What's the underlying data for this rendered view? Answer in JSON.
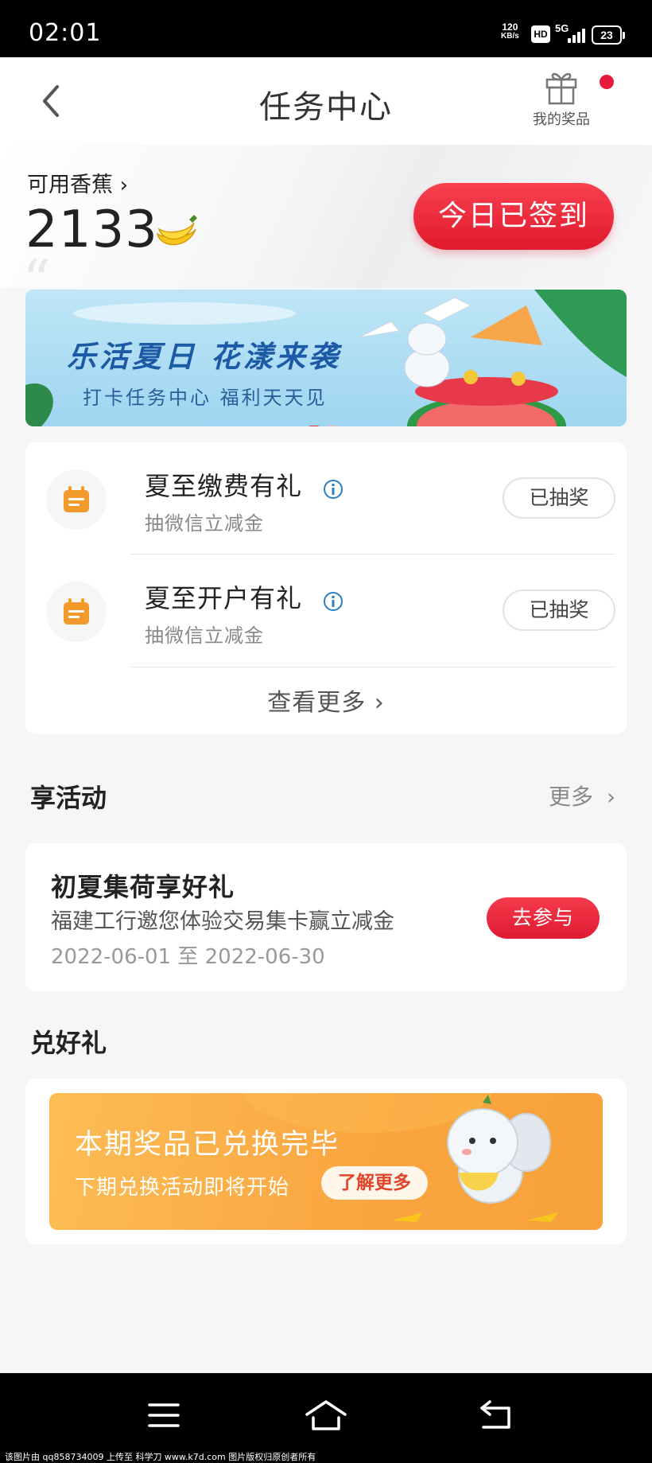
{
  "status_bar": {
    "time": "02:01",
    "speed_value": "120",
    "speed_unit": "KB/s",
    "hd": "HD",
    "network": "5G",
    "battery": "23"
  },
  "header": {
    "title": "任务中心",
    "prizes_label": "我的奖品"
  },
  "hero": {
    "banana_label": "可用香蕉",
    "banana_count": "2133",
    "signed_button": "今日已签到"
  },
  "banner": {
    "title": "乐活夏日  花漾来袭",
    "subtitle": "打卡任务中心 福利天天见"
  },
  "tasks": {
    "items": [
      {
        "title": "夏至缴费有礼",
        "desc": "抽微信立减金",
        "button": "已抽奖"
      },
      {
        "title": "夏至开户有礼",
        "desc": "抽微信立减金",
        "button": "已抽奖"
      }
    ],
    "more_label": "查看更多"
  },
  "activities": {
    "section_title": "享活动",
    "more_label": "更多",
    "item": {
      "title": "初夏集荷享好礼",
      "desc": "福建工行邀您体验交易集卡赢立减金",
      "date": "2022-06-01 至 2022-06-30",
      "button": "去参与"
    }
  },
  "redeem": {
    "section_title": "兑好礼",
    "title": "本期奖品已兑换完毕",
    "subtitle": "下期兑换活动即将开始",
    "button": "了解更多"
  },
  "footer": {
    "watermark": "该图片由 qq858734009 上传至 科学刀 www.k7d.com 图片版权归原创者所有"
  },
  "colors": {
    "accent_red": "#e11a2e",
    "task_icon_orange": "#f39a2c",
    "info_blue": "#2a7fc4",
    "redeem_orange": "#f9a43f"
  }
}
